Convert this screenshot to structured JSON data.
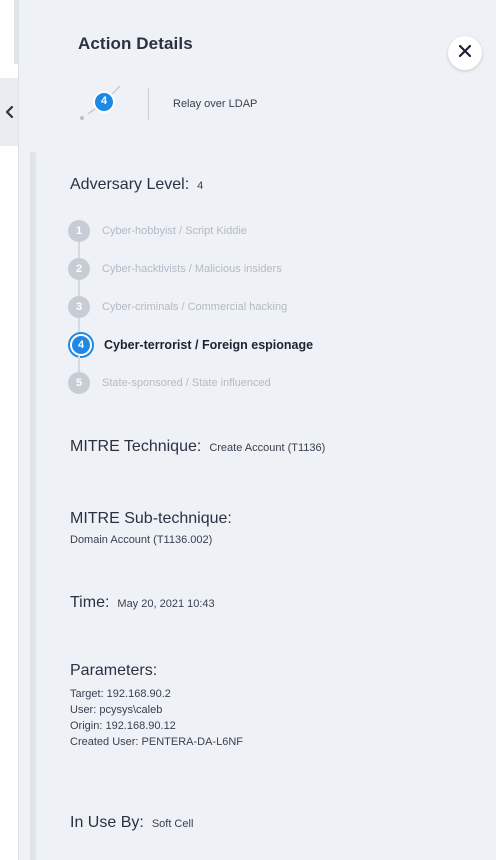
{
  "panel": {
    "title": "Action Details",
    "close_label": "×"
  },
  "action": {
    "step_number": "4",
    "name": "Relay over LDAP"
  },
  "adversary": {
    "label": "Adversary Level:",
    "value": "4",
    "levels": [
      {
        "number": "1",
        "label": "Cyber-hobbyist / Script Kiddie",
        "active": false
      },
      {
        "number": "2",
        "label": "Cyber-hacktivists / Malicious insiders",
        "active": false
      },
      {
        "number": "3",
        "label": "Cyber-criminals / Commercial hacking",
        "active": false
      },
      {
        "number": "4",
        "label": "Cyber-terrorist / Foreign espionage",
        "active": true
      },
      {
        "number": "5",
        "label": "State-sponsored / State influenced",
        "active": false
      }
    ]
  },
  "mitre_technique": {
    "label": "MITRE Technique:",
    "value": "Create Account (T1136)"
  },
  "mitre_subtechnique": {
    "label": "MITRE Sub-technique:",
    "value": "Domain Account (T1136.002)"
  },
  "time": {
    "label": "Time:",
    "value": "May 20, 2021 10:43"
  },
  "parameters": {
    "label": "Parameters:",
    "lines": [
      "Target: 192.168.90.2",
      "User: pcysys\\caleb",
      "Origin: 192.168.90.12",
      "Created User: PENTERA-DA-L6NF"
    ]
  },
  "in_use_by": {
    "label": "In Use By:",
    "value": "Soft Cell"
  },
  "colors": {
    "panel_bg": "#eef1f6",
    "accent": "#1e88e5",
    "inactive_level": "#c7ccd5",
    "heading_text": "#2b3142"
  },
  "icons": {
    "collapse": "chevron-left-icon",
    "close": "close-icon",
    "action": "action-step-icon"
  }
}
